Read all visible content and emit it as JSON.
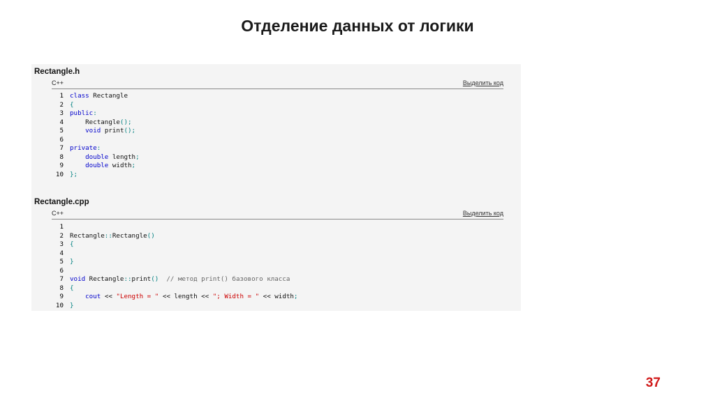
{
  "slide": {
    "title": "Отделение данных от логики",
    "page_number": "37"
  },
  "colors": {
    "keyword": "#0000cc",
    "operator": "#008080",
    "string": "#cc0000",
    "comment": "#666666",
    "page_number": "#d01818"
  },
  "blocks": [
    {
      "title": "Rectangle.h",
      "lang": "C++",
      "select_label": "Выделить код",
      "lines": [
        {
          "n": "1",
          "parts": [
            {
              "t": "kw",
              "s": "class"
            },
            {
              "t": "pl",
              "s": " Rectangle"
            }
          ]
        },
        {
          "n": "2",
          "parts": [
            {
              "t": "op",
              "s": "{"
            }
          ]
        },
        {
          "n": "3",
          "parts": [
            {
              "t": "kw",
              "s": "public"
            },
            {
              "t": "op",
              "s": ":"
            }
          ]
        },
        {
          "n": "4",
          "parts": [
            {
              "t": "pl",
              "s": "    Rectangle"
            },
            {
              "t": "op",
              "s": "();"
            }
          ]
        },
        {
          "n": "5",
          "parts": [
            {
              "t": "pl",
              "s": "    "
            },
            {
              "t": "kw",
              "s": "void"
            },
            {
              "t": "pl",
              "s": " print"
            },
            {
              "t": "op",
              "s": "();"
            }
          ]
        },
        {
          "n": "6",
          "parts": []
        },
        {
          "n": "7",
          "parts": [
            {
              "t": "kw",
              "s": "private"
            },
            {
              "t": "op",
              "s": ":"
            }
          ]
        },
        {
          "n": "8",
          "parts": [
            {
              "t": "pl",
              "s": "    "
            },
            {
              "t": "kw",
              "s": "double"
            },
            {
              "t": "pl",
              "s": " length"
            },
            {
              "t": "op",
              "s": ";"
            }
          ]
        },
        {
          "n": "9",
          "parts": [
            {
              "t": "pl",
              "s": "    "
            },
            {
              "t": "kw",
              "s": "double"
            },
            {
              "t": "pl",
              "s": " width"
            },
            {
              "t": "op",
              "s": ";"
            }
          ]
        },
        {
          "n": "10",
          "parts": [
            {
              "t": "op",
              "s": "};"
            }
          ]
        }
      ]
    },
    {
      "title": "Rectangle.cpp",
      "lang": "C++",
      "select_label": "Выделить код",
      "lines": [
        {
          "n": "1",
          "parts": []
        },
        {
          "n": "2",
          "parts": [
            {
              "t": "pl",
              "s": "Rectangle"
            },
            {
              "t": "op",
              "s": "::"
            },
            {
              "t": "pl",
              "s": "Rectangle"
            },
            {
              "t": "op",
              "s": "()"
            }
          ]
        },
        {
          "n": "3",
          "parts": [
            {
              "t": "op",
              "s": "{"
            }
          ]
        },
        {
          "n": "4",
          "parts": []
        },
        {
          "n": "5",
          "parts": [
            {
              "t": "op",
              "s": "}"
            }
          ]
        },
        {
          "n": "6",
          "parts": []
        },
        {
          "n": "7",
          "parts": [
            {
              "t": "kw",
              "s": "void"
            },
            {
              "t": "pl",
              "s": " Rectangle"
            },
            {
              "t": "op",
              "s": "::"
            },
            {
              "t": "pl",
              "s": "print"
            },
            {
              "t": "op",
              "s": "()"
            },
            {
              "t": "pl",
              "s": "  "
            },
            {
              "t": "cm",
              "s": "// метод print() базового класса"
            }
          ]
        },
        {
          "n": "8",
          "parts": [
            {
              "t": "op",
              "s": "{"
            }
          ]
        },
        {
          "n": "9",
          "parts": [
            {
              "t": "pl",
              "s": "    "
            },
            {
              "t": "kw",
              "s": "cout"
            },
            {
              "t": "pl",
              "s": " << "
            },
            {
              "t": "str",
              "s": "\"Length = \""
            },
            {
              "t": "pl",
              "s": " << length << "
            },
            {
              "t": "str",
              "s": "\"; Width = \""
            },
            {
              "t": "pl",
              "s": " << width"
            },
            {
              "t": "op",
              "s": ";"
            }
          ]
        },
        {
          "n": "10",
          "parts": [
            {
              "t": "op",
              "s": "}"
            }
          ]
        }
      ]
    }
  ]
}
